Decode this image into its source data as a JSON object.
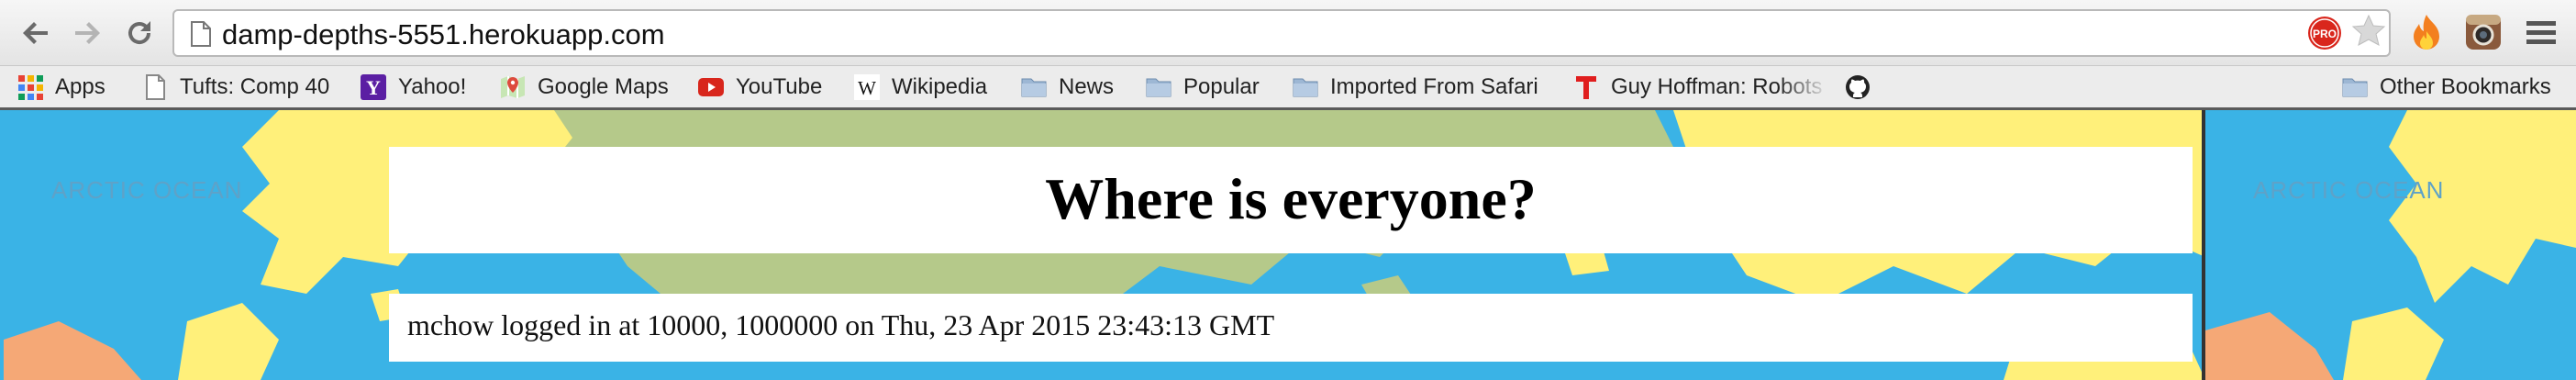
{
  "browser": {
    "url": "damp-depths-5551.herokuapp.com",
    "icons": [
      "back-icon",
      "forward-icon",
      "reload-icon",
      "page-icon",
      "pro-badge-icon",
      "star-icon",
      "fire-extension-icon",
      "camera-extension-icon",
      "menu-icon"
    ]
  },
  "bookmarks": {
    "items": [
      {
        "label": "Apps",
        "icon": "apps-grid-icon"
      },
      {
        "label": "Tufts: Comp 40",
        "icon": "page-icon"
      },
      {
        "label": "Yahoo!",
        "icon": "yahoo-icon"
      },
      {
        "label": "Google Maps",
        "icon": "google-maps-icon"
      },
      {
        "label": "YouTube",
        "icon": "youtube-icon"
      },
      {
        "label": "Wikipedia",
        "icon": "wikipedia-icon"
      },
      {
        "label": "News",
        "icon": "folder-icon"
      },
      {
        "label": "Popular",
        "icon": "folder-icon"
      },
      {
        "label": "Imported From Safari",
        "icon": "folder-icon"
      },
      {
        "label": "Guy Hoffman: Robots",
        "icon": "t-logo-icon"
      },
      {
        "label": "",
        "icon": "github-icon"
      }
    ],
    "other": "Other Bookmarks"
  },
  "map": {
    "label_left": "ARCTIC OCEAN",
    "label_right": "ARCTIC OCEAN",
    "colors": {
      "ocean": "#3ab3e6",
      "land_yellow": "#fff07a",
      "land_green": "#b5c98a",
      "land_orange": "#f5a876"
    }
  },
  "page": {
    "title": "Where is everyone?",
    "status": "mchow logged in at 10000, 1000000 on Thu, 23 Apr 2015 23:43:13 GMT"
  }
}
